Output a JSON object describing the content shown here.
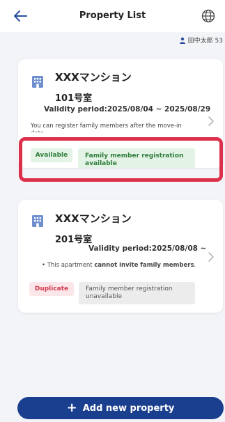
{
  "header": {
    "title": "Property List",
    "user_name": "田中太郎 53"
  },
  "properties": [
    {
      "name": "XXXマンション",
      "room": "101号室",
      "validity": "Validity period:2025/08/04 ~ 2025/08/29",
      "note": "You can register family members after the move-in date.",
      "status_badge": "Available",
      "family_badge": "Family member registration available"
    },
    {
      "name": "XXXマンション",
      "room": "201号室",
      "validity": "Validity period:2025/08/08 ~",
      "note_prefix": "• This apartment ",
      "note_bold": "cannot invite family members",
      "note_suffix": ".",
      "status_badge": "Duplicate",
      "family_badge": "Family member registration unavailable"
    }
  ],
  "add_button": {
    "label": "Add new property"
  },
  "colors": {
    "primary": "#1b3f8f",
    "highlight": "#dc2f4c",
    "available_bg": "#e3f3e6",
    "available_text": "#2f7d3a",
    "duplicate_bg": "#fbe7ea",
    "duplicate_text": "#d23a4e"
  }
}
